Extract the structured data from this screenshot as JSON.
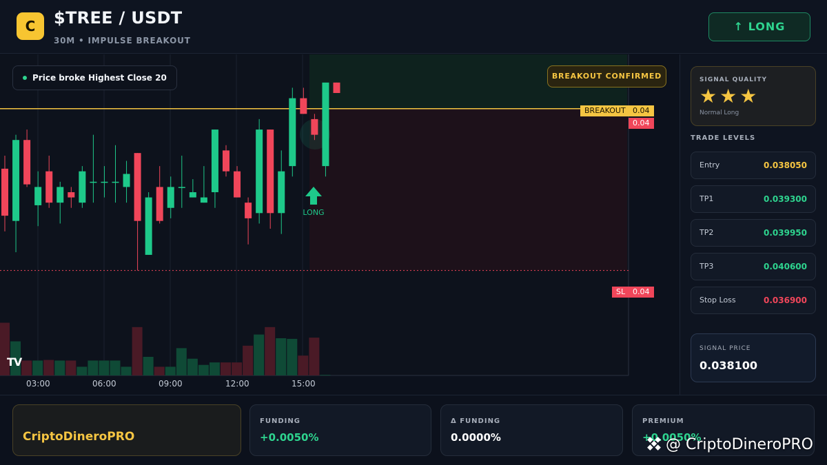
{
  "header": {
    "logo_letter": "C",
    "pair": "$TREE / USDT",
    "subtitle": "30M • IMPULSE BREAKOUT",
    "long_button": "↑ LONG"
  },
  "chart": {
    "price_note": "Price broke Highest Close 20",
    "breakout_badge": "BREAKOUT CONFIRMED",
    "breakout_label": "BREAKOUT",
    "breakout_value": "0.04",
    "current_value": "0.04",
    "sl_label": "SL",
    "sl_value": "0.04",
    "signal_label": "LONG",
    "tv_mark": "TV",
    "time_labels": [
      "03:00",
      "06:00",
      "09:00",
      "12:00",
      "15:00"
    ],
    "colors": {
      "up": "#1ec98a",
      "down": "#f0465a",
      "breakout": "#f5c542",
      "sl": "#f0465a"
    }
  },
  "chart_data": {
    "type": "candlestick",
    "x_labels": [
      "03:00",
      "06:00",
      "09:00",
      "12:00",
      "15:00"
    ],
    "ylim": [
      0.0365,
      0.0403
    ],
    "candles": [
      {
        "o": 0.03885,
        "h": 0.0391,
        "l": 0.03765,
        "c": 0.03795
      },
      {
        "o": 0.03785,
        "h": 0.0395,
        "l": 0.03725,
        "c": 0.0394
      },
      {
        "o": 0.0394,
        "h": 0.0396,
        "l": 0.0385,
        "c": 0.03855
      },
      {
        "o": 0.03815,
        "h": 0.0388,
        "l": 0.03775,
        "c": 0.0385
      },
      {
        "o": 0.0388,
        "h": 0.0391,
        "l": 0.0381,
        "c": 0.0382
      },
      {
        "o": 0.0382,
        "h": 0.0386,
        "l": 0.0378,
        "c": 0.0385
      },
      {
        "o": 0.0384,
        "h": 0.0385,
        "l": 0.0381,
        "c": 0.0383
      },
      {
        "o": 0.0382,
        "h": 0.0389,
        "l": 0.0381,
        "c": 0.0388
      },
      {
        "o": 0.0386,
        "h": 0.0395,
        "l": 0.0382,
        "c": 0.0386
      },
      {
        "o": 0.0386,
        "h": 0.0389,
        "l": 0.0383,
        "c": 0.0386
      },
      {
        "o": 0.0386,
        "h": 0.0393,
        "l": 0.0382,
        "c": 0.0386
      },
      {
        "o": 0.0385,
        "h": 0.039,
        "l": 0.0382,
        "c": 0.03875
      },
      {
        "o": 0.03915,
        "h": 0.03915,
        "l": 0.0369,
        "c": 0.03785
      },
      {
        "o": 0.0372,
        "h": 0.0384,
        "l": 0.0372,
        "c": 0.0383
      },
      {
        "o": 0.0385,
        "h": 0.0389,
        "l": 0.0378,
        "c": 0.03785
      },
      {
        "o": 0.0381,
        "h": 0.0387,
        "l": 0.0379,
        "c": 0.0385
      },
      {
        "o": 0.0385,
        "h": 0.0391,
        "l": 0.0381,
        "c": 0.0385
      },
      {
        "o": 0.0383,
        "h": 0.03865,
        "l": 0.0383,
        "c": 0.0384
      },
      {
        "o": 0.0382,
        "h": 0.0389,
        "l": 0.0382,
        "c": 0.0383
      },
      {
        "o": 0.0384,
        "h": 0.0396,
        "l": 0.0381,
        "c": 0.0396
      },
      {
        "o": 0.0392,
        "h": 0.0393,
        "l": 0.0387,
        "c": 0.0388
      },
      {
        "o": 0.0388,
        "h": 0.0389,
        "l": 0.0383,
        "c": 0.0383
      },
      {
        "o": 0.0382,
        "h": 0.0383,
        "l": 0.0374,
        "c": 0.0379
      },
      {
        "o": 0.038,
        "h": 0.0398,
        "l": 0.0378,
        "c": 0.0396
      },
      {
        "o": 0.0396,
        "h": 0.0396,
        "l": 0.0377,
        "c": 0.038
      },
      {
        "o": 0.038,
        "h": 0.0392,
        "l": 0.0376,
        "c": 0.0388
      },
      {
        "o": 0.0389,
        "h": 0.0404,
        "l": 0.0387,
        "c": 0.0402
      },
      {
        "o": 0.0402,
        "h": 0.0404,
        "l": 0.0399,
        "c": 0.0399
      },
      {
        "o": 0.0398,
        "h": 0.0399,
        "l": 0.0394,
        "c": 0.0395
      },
      {
        "o": 0.0389,
        "h": 0.0404,
        "l": 0.0387,
        "c": 0.0405
      },
      {
        "o": 0.0405,
        "h": 0.0405,
        "l": 0.0403,
        "c": 0.0403
      }
    ],
    "volume": [
      85,
      55,
      24,
      24,
      25,
      24,
      24,
      14,
      24,
      24,
      24,
      14,
      78,
      30,
      14,
      14,
      44,
      27,
      17,
      21,
      21,
      21,
      48,
      66,
      78,
      60,
      59,
      32,
      61,
      1
    ],
    "breakout_level": 0.04,
    "stop_loss_level": 0.0369
  },
  "right_panel": {
    "signal_quality_title": "SIGNAL QUALITY",
    "stars": "★★★",
    "star_count": 3,
    "quality_text": "Normal Long",
    "trade_levels_title": "TRADE LEVELS",
    "levels": [
      {
        "label": "Entry",
        "value": "0.038050",
        "color": "#f5c542"
      },
      {
        "label": "TP1",
        "value": "0.039300",
        "color": "#2ed48f"
      },
      {
        "label": "TP2",
        "value": "0.039950",
        "color": "#2ed48f"
      },
      {
        "label": "TP3",
        "value": "0.040600",
        "color": "#2ed48f"
      },
      {
        "label": "Stop Loss",
        "value": "0.036900",
        "color": "#f0465a"
      }
    ],
    "signal_price_title": "SIGNAL PRICE",
    "signal_price": "0.038100"
  },
  "footer": {
    "brand": "CriptoDineroPRO",
    "stats": [
      {
        "title": "FUNDING",
        "value": "+0.0050%",
        "color": "#2ed48f"
      },
      {
        "title": "Δ FUNDING",
        "value": "0.0000%",
        "color": "#ffffff"
      },
      {
        "title": "PREMIUM",
        "value": "+0.0050%",
        "color": "#2ed48f"
      }
    ],
    "watermark": "@ CriptoDineroPRO"
  }
}
